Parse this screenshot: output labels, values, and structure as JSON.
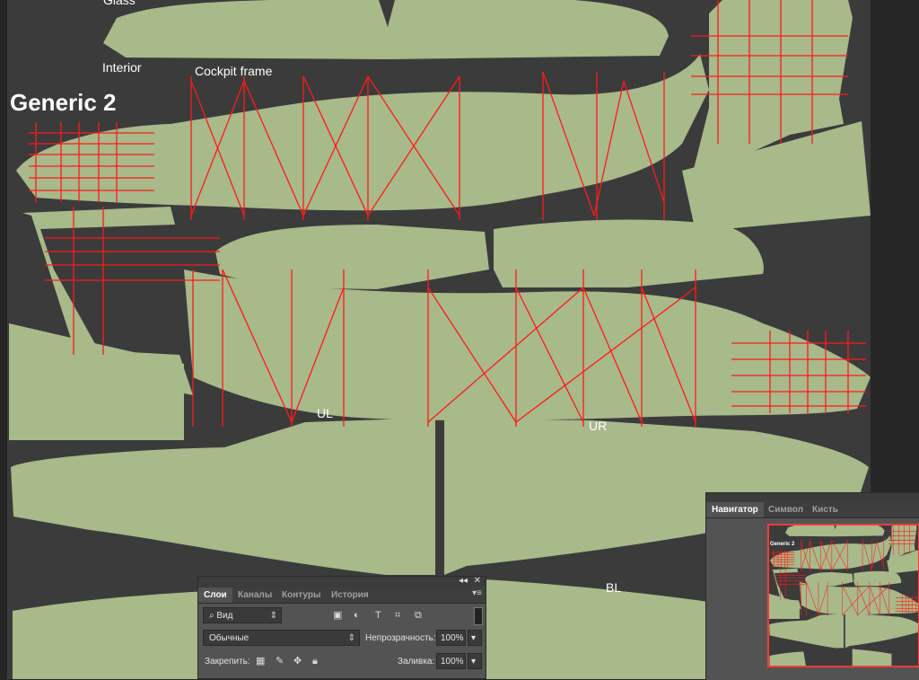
{
  "canvas": {
    "labels": {
      "glass": "Glass",
      "interior": "Interior",
      "cockpit_frame": "Cockpit frame",
      "generic": "Generic 2",
      "ul": "UL",
      "ur": "UR",
      "bl": "BL"
    },
    "colors": {
      "background": "#262626",
      "document": "#3b3b3b",
      "shape_fill": "#a8b98a",
      "guide_lines": "#ff1a1a"
    }
  },
  "layers_panel": {
    "tabs": [
      "Слои",
      "Каналы",
      "Контуры",
      "История"
    ],
    "active_tab": "Слои",
    "filter_kind": "Вид",
    "blend_mode": "Обычные",
    "opacity_label": "Непрозрачность:",
    "opacity_value": "100%",
    "lock_label": "Закрепить:",
    "fill_label": "Заливка:",
    "fill_value": "100%",
    "collapse_glyph": "◂◂",
    "close_glyph": "✕"
  },
  "navigator_panel": {
    "tabs": [
      "Навигатор",
      "Символ",
      "Кисть"
    ],
    "active_tab": "Навигатор",
    "thumb_label": "Generic 2"
  }
}
